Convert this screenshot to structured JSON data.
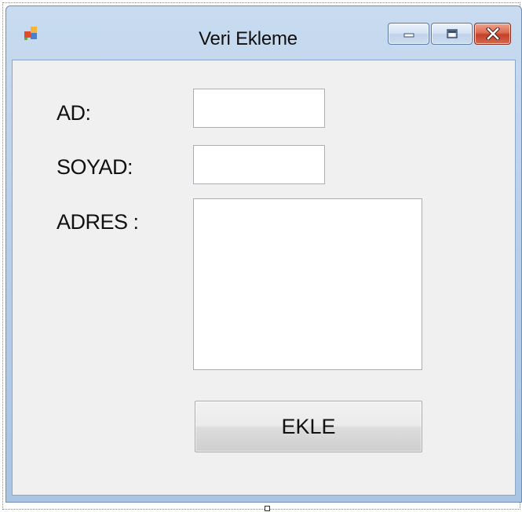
{
  "window": {
    "title": "Veri Ekleme",
    "caption_buttons": [
      "minimize-icon",
      "maximize-icon",
      "close-icon"
    ]
  },
  "form": {
    "ad_label": "AD:",
    "soyad_label": "SOYAD:",
    "adres_label": "ADRES :",
    "ad_value": "",
    "soyad_value": "",
    "adres_value": "",
    "ekle_label": "EKLE"
  },
  "colors": {
    "close_button": "#c4402a",
    "titlebar": "#b7cee9",
    "client_background": "#f0f0f0"
  }
}
